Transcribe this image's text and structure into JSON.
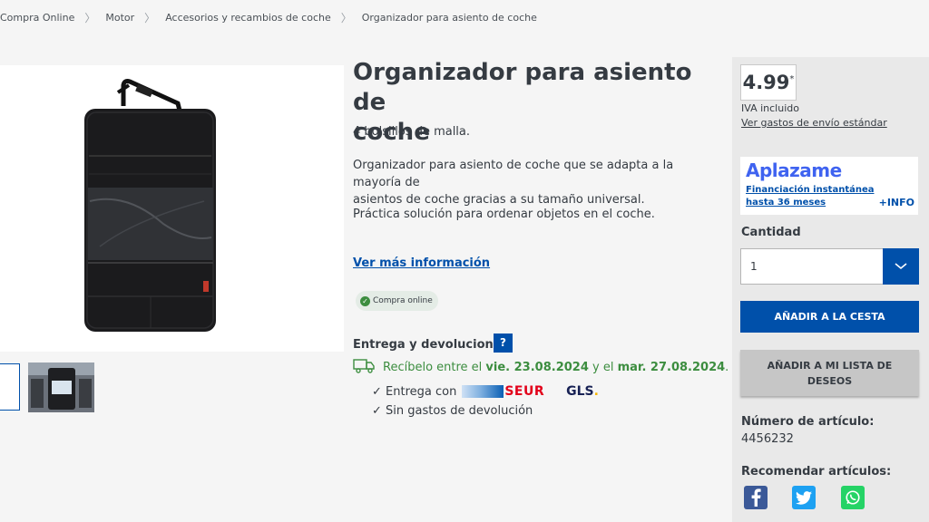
{
  "breadcrumb": {
    "items": [
      "Compra Online",
      "Motor",
      "Accesorios y recambios de coche",
      "Organizador para asiento de coche"
    ]
  },
  "product": {
    "title_line1": "Organizador para asiento de",
    "title_line2": "coche",
    "subtitle": "4 bolsillos de malla.",
    "description_line1": "Organizador para asiento de coche que se adapta a la mayoría de",
    "description_line2": "asientos de coche gracias a su tamaño universal.",
    "description2": "Práctica solución para ordenar objetos en el coche.",
    "more_info": "Ver más información",
    "badge": "Compra online"
  },
  "delivery": {
    "title": "Entrega y devoluciones:",
    "help": "?",
    "receive_prefix": "Recíbelo entre el ",
    "date_from": "vie. 23.08.2024",
    "receive_mid": " y el ",
    "date_to": "mar. 27.08.2024",
    "receive_suffix": ".",
    "check1": "✓ Entrega con",
    "seur": "SEUR",
    "gls": "GLS",
    "gls_dot": ".",
    "check2": "✓ Sin gastos de devolución"
  },
  "sidebar": {
    "price": "4.99",
    "price_mark": "*",
    "vat": "IVA incluido",
    "shipping_link": "Ver gastos de envío estándar",
    "aplazame_logo": "Aplazame",
    "aplazame_line1": "Financiación instantánea",
    "aplazame_line2": "hasta 36 meses",
    "aplazame_info": "+INFO",
    "qty_label": "Cantidad",
    "qty_value": "1",
    "add_cart": "AÑADIR A LA CESTA",
    "add_wish_line1": "AÑADIR A MI LISTA DE",
    "add_wish_line2": "DESEOS",
    "article_label": "Número de artículo:",
    "article_number": "4456232",
    "recommend_label": "Recomendar artículos:"
  },
  "colors": {
    "primary": "#0050aa",
    "success": "#3c8d3f",
    "seur": "#e2001a",
    "aplazame": "#3f63f0"
  },
  "icons": [
    "chevron-right-icon",
    "check-circle-icon",
    "truck-icon",
    "chevron-down-icon",
    "facebook-icon",
    "twitter-icon",
    "whatsapp-icon"
  ]
}
